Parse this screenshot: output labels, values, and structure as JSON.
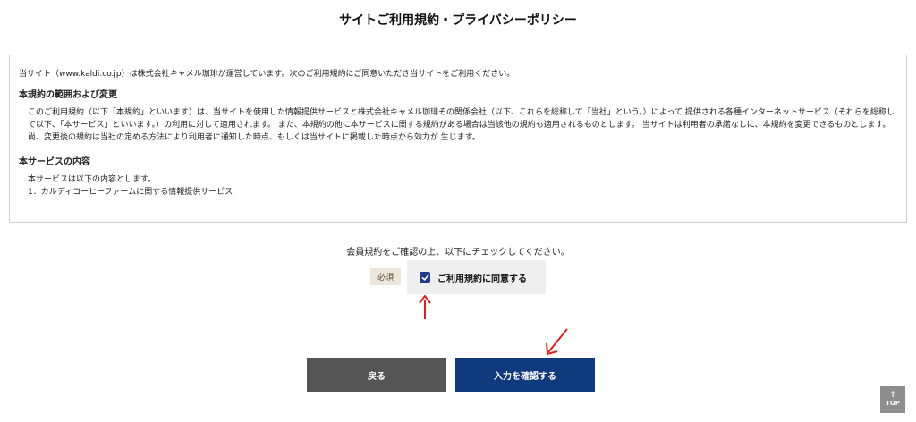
{
  "page_title": "サイトご利用規約・プライバシーポリシー",
  "terms": {
    "intro": "当サイト（www.kaldi.co.jp）は株式会社キャメル珈琲が運営しています。次のご利用規約にご同意いただき当サイトをご利用ください。",
    "section1_heading": "本規約の範囲および変更",
    "section1_body": "このご利用規約（以下「本規約」といいます）は、当サイトを使用した情報提供サービスと株式会社キャメル珈琲その関係会社（以下、これらを総称して「当社」という。）によって 提供される各種インターネットサービス（それらを総称して以下、「本サービス」といいます。）の利用に対して適用されます。 また、本規約の他に本サービスに関する規約がある場合は当該他の規約も適用されるものとします。 当サイトは利用者の承諾なしに、本規約を変更できるものとします。尚、変更後の規約は当社の定める方法により利用者に通知した時点、もしくは当サイトに掲載した時点から効力が 生じます。",
    "section2_heading": "本サービスの内容",
    "section2_body": "本サービスは以下の内容とします。",
    "section2_item1": "1．カルディコーヒーファームに関する情報提供サービス"
  },
  "confirm_text": "会員規約をご確認の上、以下にチェックしてください。",
  "required_badge": "必須",
  "agree_label": "ご利用規約に同意する",
  "agree_checked": true,
  "buttons": {
    "back": "戻る",
    "confirm": "入力を確認する"
  },
  "top_button": {
    "arrow": "↑",
    "label": "TOP"
  },
  "colors": {
    "confirm_button": "#0f3a7d",
    "back_button": "#555555",
    "checkbox": "#1f3a8a",
    "arrow": "#e0201c"
  }
}
